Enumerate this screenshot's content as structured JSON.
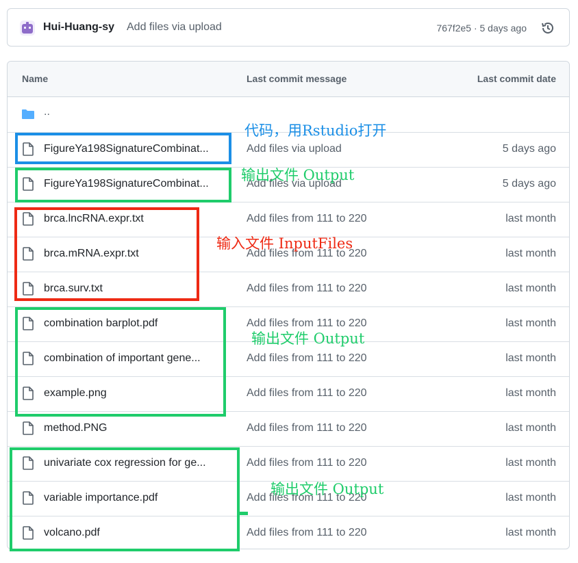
{
  "commit": {
    "author": "Hui-Huang-sy",
    "message": "Add files via upload",
    "meta": "767f2e5 · 5 days ago",
    "avatar_icon": "avatar-icon",
    "history_icon": "history-icon"
  },
  "table": {
    "headers": {
      "name": "Name",
      "message": "Last commit message",
      "date": "Last commit date"
    },
    "parent_dir": "..",
    "rows": [
      {
        "name": "FigureYa198SignatureCombinat...",
        "message": "Add files via upload",
        "date": "5 days ago"
      },
      {
        "name": "FigureYa198SignatureCombinat...",
        "message": "Add files via upload",
        "date": "5 days ago"
      },
      {
        "name": "brca.lncRNA.expr.txt",
        "message": "Add files from 111 to 220",
        "date": "last month"
      },
      {
        "name": "brca.mRNA.expr.txt",
        "message": "Add files from 111 to 220",
        "date": "last month"
      },
      {
        "name": "brca.surv.txt",
        "message": "Add files from 111 to 220",
        "date": "last month"
      },
      {
        "name": "combination barplot.pdf",
        "message": "Add files from 111 to 220",
        "date": "last month"
      },
      {
        "name": "combination of important gene...",
        "message": "Add files from 111 to 220",
        "date": "last month"
      },
      {
        "name": "example.png",
        "message": "Add files from 111 to 220",
        "date": "last month"
      },
      {
        "name": "method.PNG",
        "message": "Add files from 111 to 220",
        "date": "last month"
      },
      {
        "name": "univariate cox regression for ge...",
        "message": "Add files from 111 to 220",
        "date": "last month"
      },
      {
        "name": "variable importance.pdf",
        "message": "Add files from 111 to 220",
        "date": "last month"
      },
      {
        "name": "volcano.pdf",
        "message": "Add files from 111 to 220",
        "date": "last month"
      }
    ]
  },
  "annotations": {
    "code": "代码，用Rstudio打开",
    "output1": "输出文件 Output",
    "input": "输入文件 InputFiles",
    "output2": "输出文件 Output",
    "output3": "输出文件 Output"
  },
  "colors": {
    "blue": "#1b8fe6",
    "green": "#1fcc6b",
    "red": "#ee2a14",
    "folder": "#54aeff"
  }
}
